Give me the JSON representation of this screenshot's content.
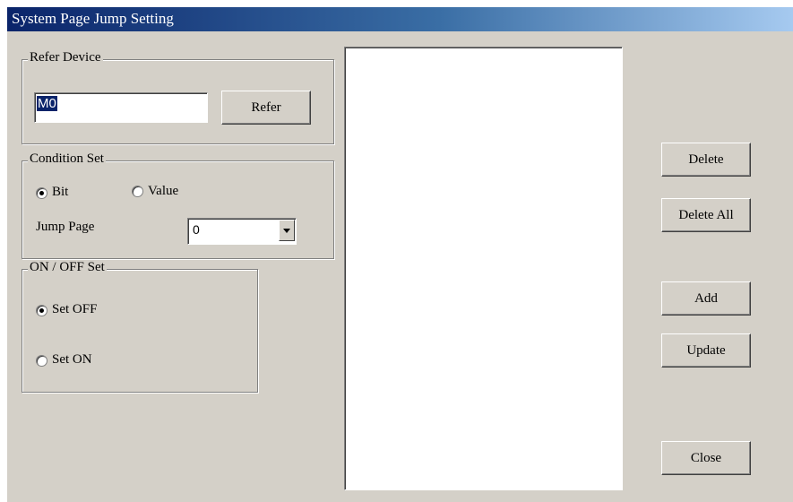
{
  "window": {
    "title": "System Page Jump Setting"
  },
  "refer_device": {
    "legend": "Refer Device",
    "input_value": "M0",
    "refer_button": "Refer"
  },
  "condition_set": {
    "legend": "Condition Set",
    "option_bit": "Bit",
    "option_value": "Value",
    "selected": "Bit",
    "jump_page_label": "Jump Page",
    "jump_page_value": "0"
  },
  "onoff_set": {
    "legend": "ON / OFF Set",
    "option_off": "Set OFF",
    "option_on": "Set ON",
    "selected": "Set OFF"
  },
  "list": {
    "items": []
  },
  "buttons": {
    "delete": "Delete",
    "delete_all": "Delete All",
    "add": "Add",
    "update": "Update",
    "close": "Close"
  }
}
